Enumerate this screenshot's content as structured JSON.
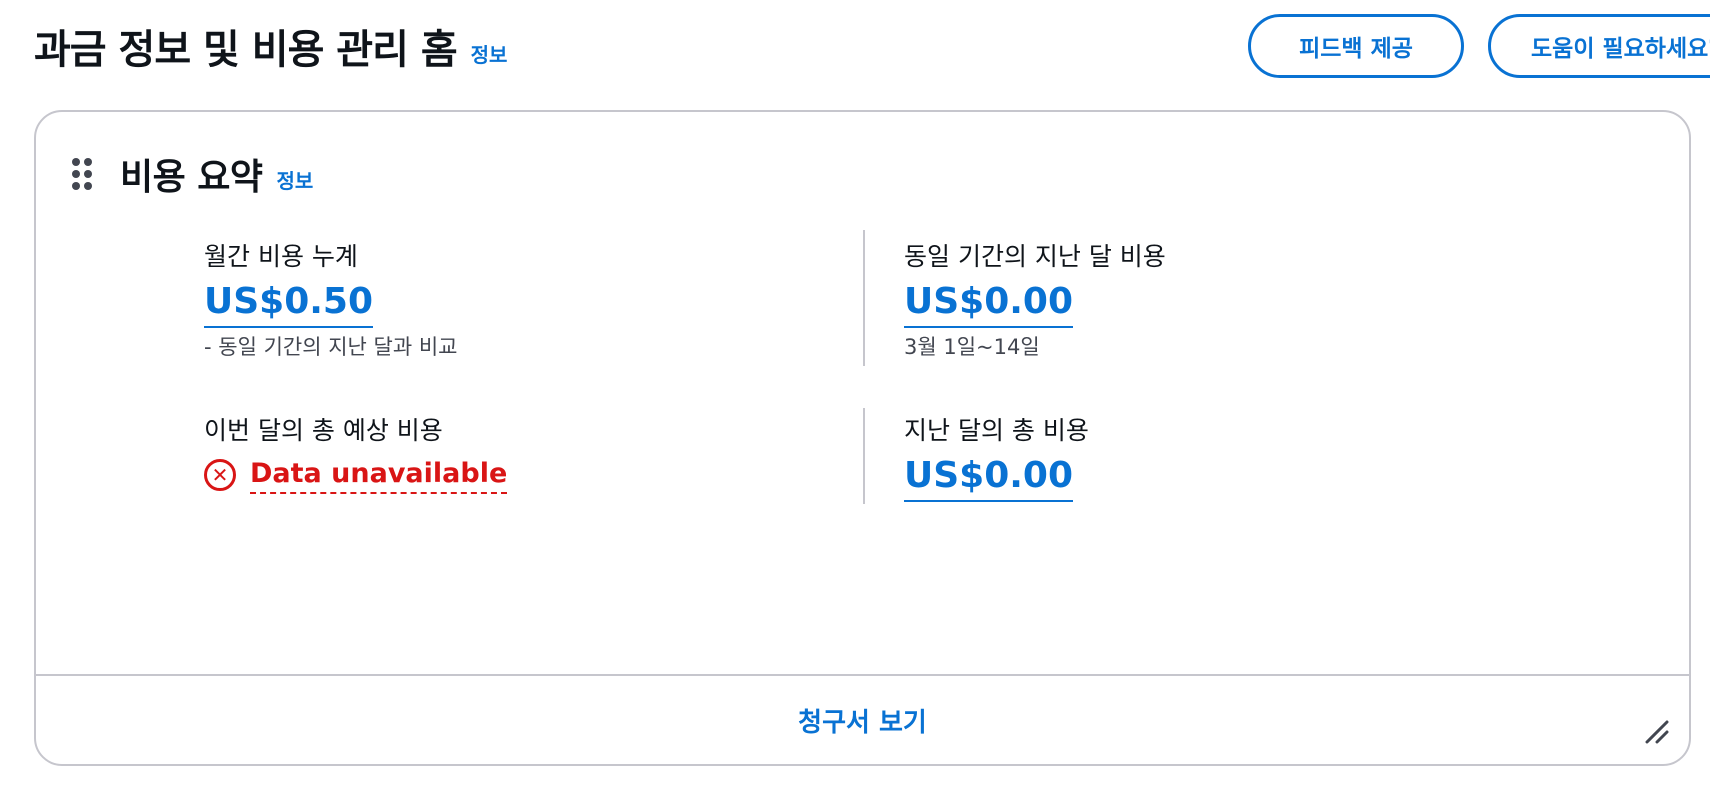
{
  "header": {
    "title": "과금 정보 및 비용 관리 홈",
    "info_label": "정보",
    "feedback_button": "피드백 제공",
    "help_button": "도움이 필요하세요?"
  },
  "cost_summary": {
    "title": "비용 요약",
    "info_label": "정보",
    "month_to_date": {
      "label": "월간 비용 누계",
      "value": "US$0.50",
      "sub": "- 동일 기간의 지난 달과 비교"
    },
    "last_month_same_period": {
      "label": "동일 기간의 지난 달 비용",
      "value": "US$0.00",
      "sub": "3월 1일~14일"
    },
    "forecast": {
      "label": "이번 달의 총 예상 비용",
      "error_text": "Data unavailable"
    },
    "last_month_total": {
      "label": "지난 달의 총 비용",
      "value": "US$0.00"
    },
    "footer_link": "청구서 보기"
  },
  "icons": {
    "drag": "drag-handle-icon",
    "error": "error-circle-icon",
    "resize": "resize-handle-icon"
  },
  "colors": {
    "link": "#0972d3",
    "error": "#d91515",
    "border": "#c6c6cd",
    "text": "#0f141a"
  }
}
